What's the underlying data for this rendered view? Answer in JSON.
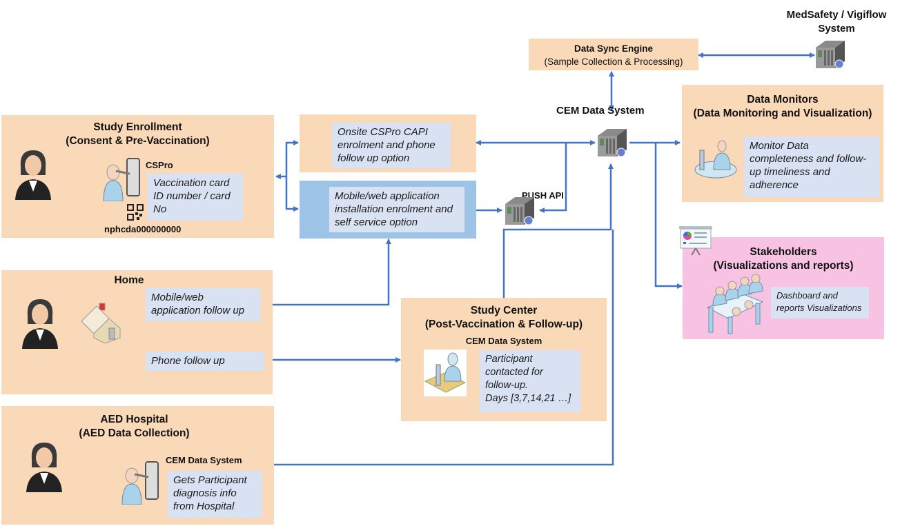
{
  "medsafety": {
    "label_line1": "MedSafety / Vigiflow",
    "label_line2": "System"
  },
  "data_sync": {
    "title": "Data Sync Engine",
    "subtitle": "(Sample Collection & Processing)"
  },
  "cem_hub": {
    "label": "CEM Data System"
  },
  "push_api": {
    "label": "PUSH API"
  },
  "enrollment": {
    "title": "Study Enrollment",
    "subtitle": "(Consent & Pre-Vaccination)",
    "app_label": "CSPro",
    "note": [
      "Vaccination card",
      "ID number / card",
      "No"
    ],
    "qr_id": "nphcda000000000"
  },
  "onsite": {
    "note": [
      "Onsite CSPro CAPI",
      "enrolment and phone",
      "follow up option"
    ]
  },
  "mobile_app": {
    "note": [
      "Mobile/web application",
      "installation enrolment and",
      "self service option"
    ]
  },
  "data_monitors": {
    "title": "Data Monitors",
    "subtitle": "(Data Monitoring and Visualization)",
    "note": [
      "Monitor Data",
      "completeness and follow-",
      "up timeliness and",
      "adherence"
    ]
  },
  "stakeholders": {
    "title": "Stakeholders",
    "subtitle": "(Visualizations and reports)",
    "note": [
      "Dashboard and",
      "reports Visualizations"
    ]
  },
  "home": {
    "title": "Home",
    "note_mobile": [
      "Mobile/web",
      "application follow up"
    ],
    "note_phone": "Phone follow up"
  },
  "study_center": {
    "title": "Study Center",
    "subtitle": "(Post-Vaccination & Follow-up)",
    "system_label": "CEM Data System",
    "note": [
      "Participant",
      "contacted for",
      "follow-up.",
      "Days [3,7,14,21 …]"
    ]
  },
  "hospital": {
    "title": "AED Hospital",
    "subtitle": "(AED Data Collection)",
    "system_label": "CEM Data System",
    "note": [
      "Gets Participant",
      "diagnosis info",
      "from Hospital"
    ]
  },
  "colors": {
    "connector": "#4472c4",
    "box": "#fad9b8",
    "note": "#d9e2f3",
    "app_box": "#9dc3e6",
    "stakeholder_box": "#f8c3e2"
  }
}
